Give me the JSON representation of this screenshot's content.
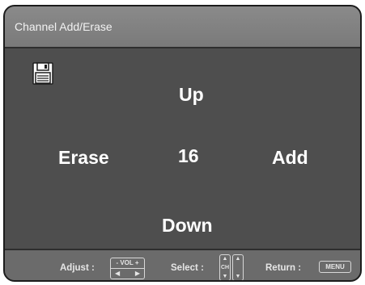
{
  "title": "Channel Add/Erase",
  "icons": {
    "save": "floppy-disk-icon"
  },
  "options": {
    "up": "Up",
    "erase": "Erase",
    "channel_number": "16",
    "add": "Add",
    "down": "Down"
  },
  "footer": {
    "adjust_label": "Adjust :",
    "vol_key": "- VOL +",
    "vol_left_arrow": "◀",
    "vol_right_arrow": "▶",
    "select_label": "Select :",
    "ch_key": "CH",
    "arrow_up": "▲",
    "arrow_down": "▼",
    "return_label": "Return :",
    "menu_key": "MENU"
  },
  "colors": {
    "panel": "#4e4e4e",
    "title_bar": "#808080",
    "footer": "#6b6b6b",
    "text": "#ffffff"
  }
}
